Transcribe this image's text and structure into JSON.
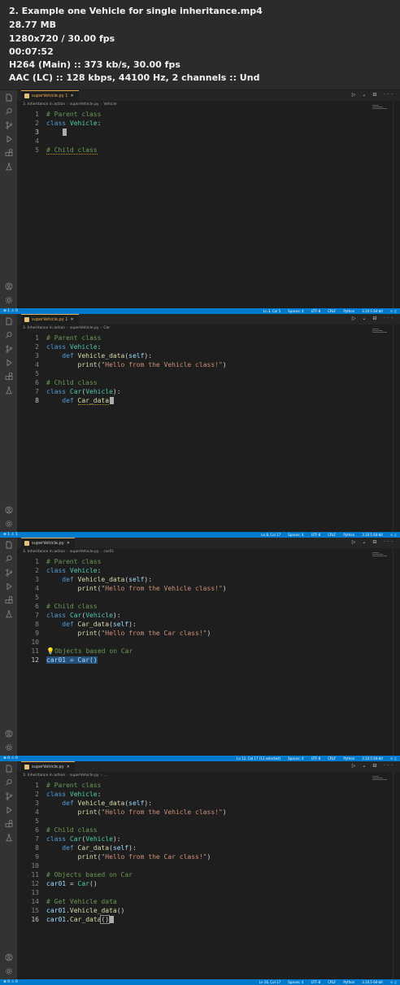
{
  "header": {
    "title": "2. Example one Vehicle for single inheritance.mp4",
    "size": "28.77 MB",
    "resolution": "1280x720 / 30.00 fps",
    "duration": "00:07:52",
    "video": "H264 (Main) :: 373 kb/s, 30.00 fps",
    "audio": "AAC (LC) :: 128 kbps, 44100 Hz, 2 channels :: Und"
  },
  "activity_icons": [
    "files-icon",
    "search-icon",
    "source-control-icon",
    "run-debug-icon",
    "extensions-icon",
    "testing-icon"
  ],
  "bottom_icons": [
    "account-icon",
    "settings-gear-icon"
  ],
  "tab_actions": "▷ ⌄ ⊟ ···",
  "frames": [
    {
      "tab_name": "superVehicle.py 1",
      "tab_close": "✕",
      "tab_modified": true,
      "breadcrumb": [
        "3. Inheritance in action",
        "superVehicle.py",
        "Vehicle"
      ],
      "status_left": "⊗ 1 ⚠ 0",
      "status_right": [
        "Ln 3, Col 5",
        "Spaces: 4",
        "UTF-8",
        "CRLF",
        "Python",
        "3.10.5 64-bit",
        "⟐ ♫"
      ],
      "lines": [
        {
          "n": "1",
          "tokens": [
            {
              "t": "# Parent class",
              "c": "c-comment"
            }
          ]
        },
        {
          "n": "2",
          "tokens": [
            {
              "t": "class ",
              "c": "c-kw"
            },
            {
              "t": "Vehicle",
              "c": "c-cls"
            },
            {
              "t": ":",
              "c": "c-plain"
            }
          ]
        },
        {
          "n": "3",
          "cur": true,
          "tokens": [
            {
              "t": "    ",
              "c": "c-plain"
            }
          ],
          "cursor": true
        },
        {
          "n": "4",
          "tokens": []
        },
        {
          "n": "5",
          "tokens": [
            {
              "t": "# Child class",
              "c": "c-comment squiggle"
            }
          ]
        }
      ]
    },
    {
      "tab_name": "superVehicle.py 1",
      "tab_close": "✕",
      "tab_modified": true,
      "breadcrumb": [
        "3. Inheritance in action",
        "superVehicle.py",
        "Car"
      ],
      "status_left": "⊗ 1 ⚠ 1",
      "status_right": [
        "Ln 8, Col 17",
        "Spaces: 4",
        "UTF-8",
        "CRLF",
        "Python",
        "3.10.5 64-bit",
        "⟐ ♫"
      ],
      "lines": [
        {
          "n": "1",
          "tokens": [
            {
              "t": "# Parent class",
              "c": "c-comment"
            }
          ]
        },
        {
          "n": "2",
          "tokens": [
            {
              "t": "class ",
              "c": "c-kw"
            },
            {
              "t": "Vehicle",
              "c": "c-cls"
            },
            {
              "t": ":",
              "c": "c-plain"
            }
          ]
        },
        {
          "n": "3",
          "tokens": [
            {
              "t": "    def ",
              "c": "c-kw"
            },
            {
              "t": "Vehicle_data",
              "c": "c-fn"
            },
            {
              "t": "(",
              "c": "c-plain"
            },
            {
              "t": "self",
              "c": "c-var"
            },
            {
              "t": "):",
              "c": "c-plain"
            }
          ]
        },
        {
          "n": "4",
          "tokens": [
            {
              "t": "        ",
              "c": "c-plain"
            },
            {
              "t": "print",
              "c": "c-fn"
            },
            {
              "t": "(",
              "c": "c-plain"
            },
            {
              "t": "\"Hello from the Vehicle class!\"",
              "c": "c-str"
            },
            {
              "t": ")",
              "c": "c-plain"
            }
          ]
        },
        {
          "n": "5",
          "tokens": []
        },
        {
          "n": "6",
          "tokens": [
            {
              "t": "# Child class",
              "c": "c-comment"
            }
          ]
        },
        {
          "n": "7",
          "tokens": [
            {
              "t": "class ",
              "c": "c-kw"
            },
            {
              "t": "Car",
              "c": "c-cls"
            },
            {
              "t": "(",
              "c": "c-plain"
            },
            {
              "t": "Vehicle",
              "c": "c-cls"
            },
            {
              "t": "):",
              "c": "c-plain"
            }
          ]
        },
        {
          "n": "8",
          "cur": true,
          "tokens": [
            {
              "t": "    def ",
              "c": "c-kw"
            },
            {
              "t": "Car_data",
              "c": "c-fn squiggle"
            }
          ],
          "cursor": true
        }
      ]
    },
    {
      "tab_name": "superVehicle.py",
      "tab_close": "✕",
      "tab_modified": false,
      "breadcrumb": [
        "3. Inheritance in action",
        "superVehicle.py",
        "car01"
      ],
      "status_left": "⊗ 0 ⚠ 0",
      "status_right": [
        "Ln 12, Col 17 (13 selected)",
        "Spaces: 4",
        "UTF-8",
        "CRLF",
        "Python",
        "3.10.5 64-bit",
        "⟐ ♫"
      ],
      "lines": [
        {
          "n": "1",
          "tokens": [
            {
              "t": "# Parent class",
              "c": "c-comment"
            }
          ]
        },
        {
          "n": "2",
          "tokens": [
            {
              "t": "class ",
              "c": "c-kw"
            },
            {
              "t": "Vehicle",
              "c": "c-cls"
            },
            {
              "t": ":",
              "c": "c-plain"
            }
          ]
        },
        {
          "n": "3",
          "tokens": [
            {
              "t": "    def ",
              "c": "c-kw"
            },
            {
              "t": "Vehicle_data",
              "c": "c-fn"
            },
            {
              "t": "(",
              "c": "c-plain"
            },
            {
              "t": "self",
              "c": "c-var"
            },
            {
              "t": "):",
              "c": "c-plain"
            }
          ]
        },
        {
          "n": "4",
          "tokens": [
            {
              "t": "        ",
              "c": "c-plain"
            },
            {
              "t": "print",
              "c": "c-fn"
            },
            {
              "t": "(",
              "c": "c-plain"
            },
            {
              "t": "\"Hello from the Vehicle class!\"",
              "c": "c-str"
            },
            {
              "t": ")",
              "c": "c-plain"
            }
          ]
        },
        {
          "n": "5",
          "tokens": []
        },
        {
          "n": "6",
          "tokens": [
            {
              "t": "# Child class",
              "c": "c-comment"
            }
          ]
        },
        {
          "n": "7",
          "tokens": [
            {
              "t": "class ",
              "c": "c-kw"
            },
            {
              "t": "Car",
              "c": "c-cls"
            },
            {
              "t": "(",
              "c": "c-plain"
            },
            {
              "t": "Vehicle",
              "c": "c-cls"
            },
            {
              "t": "):",
              "c": "c-plain"
            }
          ]
        },
        {
          "n": "8",
          "tokens": [
            {
              "t": "    def ",
              "c": "c-kw"
            },
            {
              "t": "Car_data",
              "c": "c-fn"
            },
            {
              "t": "(",
              "c": "c-plain"
            },
            {
              "t": "self",
              "c": "c-var"
            },
            {
              "t": "):",
              "c": "c-plain"
            }
          ]
        },
        {
          "n": "9",
          "tokens": [
            {
              "t": "        ",
              "c": "c-plain"
            },
            {
              "t": "print",
              "c": "c-fn"
            },
            {
              "t": "(",
              "c": "c-plain"
            },
            {
              "t": "\"Hello from the Car class!\"",
              "c": "c-str"
            },
            {
              "t": ")",
              "c": "c-plain"
            }
          ]
        },
        {
          "n": "10",
          "tokens": []
        },
        {
          "n": "11",
          "tokens": [
            {
              "t": "💡",
              "c": "lightbulb"
            },
            {
              "t": "Objects based on Car",
              "c": "c-comment"
            }
          ]
        },
        {
          "n": "12",
          "cur": true,
          "tokens": [
            {
              "t": "car01 = Car()",
              "c": "c-var sel"
            }
          ]
        }
      ]
    },
    {
      "tab_name": "superVehicle.py",
      "tab_close": "✕",
      "tab_modified": false,
      "breadcrumb": [
        "3. Inheritance in action",
        "superVehicle.py",
        "..."
      ],
      "status_left": "⊗ 0 ⚠ 0",
      "status_right": [
        "Ln 16, Col 17",
        "Spaces: 4",
        "UTF-8",
        "CRLF",
        "Python",
        "3.10.5 64-bit",
        "⟐ ♫"
      ],
      "lines": [
        {
          "n": "1",
          "tokens": [
            {
              "t": "# Parent class",
              "c": "c-comment"
            }
          ]
        },
        {
          "n": "2",
          "tokens": [
            {
              "t": "class ",
              "c": "c-kw"
            },
            {
              "t": "Vehicle",
              "c": "c-cls"
            },
            {
              "t": ":",
              "c": "c-plain"
            }
          ]
        },
        {
          "n": "3",
          "tokens": [
            {
              "t": "    def ",
              "c": "c-kw"
            },
            {
              "t": "Vehicle_data",
              "c": "c-fn"
            },
            {
              "t": "(",
              "c": "c-plain"
            },
            {
              "t": "self",
              "c": "c-var"
            },
            {
              "t": "):",
              "c": "c-plain"
            }
          ]
        },
        {
          "n": "4",
          "tokens": [
            {
              "t": "        ",
              "c": "c-plain"
            },
            {
              "t": "print",
              "c": "c-fn"
            },
            {
              "t": "(",
              "c": "c-plain"
            },
            {
              "t": "\"Hello from the Vehicle class!\"",
              "c": "c-str"
            },
            {
              "t": ")",
              "c": "c-plain"
            }
          ]
        },
        {
          "n": "5",
          "tokens": []
        },
        {
          "n": "6",
          "tokens": [
            {
              "t": "# Child class",
              "c": "c-comment"
            }
          ]
        },
        {
          "n": "7",
          "tokens": [
            {
              "t": "class ",
              "c": "c-kw"
            },
            {
              "t": "Car",
              "c": "c-cls"
            },
            {
              "t": "(",
              "c": "c-plain"
            },
            {
              "t": "Vehicle",
              "c": "c-cls"
            },
            {
              "t": "):",
              "c": "c-plain"
            }
          ]
        },
        {
          "n": "8",
          "tokens": [
            {
              "t": "    def ",
              "c": "c-kw"
            },
            {
              "t": "Car_data",
              "c": "c-fn"
            },
            {
              "t": "(",
              "c": "c-plain"
            },
            {
              "t": "self",
              "c": "c-var"
            },
            {
              "t": "):",
              "c": "c-plain"
            }
          ]
        },
        {
          "n": "9",
          "tokens": [
            {
              "t": "        ",
              "c": "c-plain"
            },
            {
              "t": "print",
              "c": "c-fn"
            },
            {
              "t": "(",
              "c": "c-plain"
            },
            {
              "t": "\"Hello from the Car class!\"",
              "c": "c-str"
            },
            {
              "t": ")",
              "c": "c-plain"
            }
          ]
        },
        {
          "n": "10",
          "tokens": []
        },
        {
          "n": "11",
          "tokens": [
            {
              "t": "# Objects based on Car",
              "c": "c-comment"
            }
          ]
        },
        {
          "n": "12",
          "tokens": [
            {
              "t": "car01",
              "c": "c-var"
            },
            {
              "t": " = ",
              "c": "c-plain"
            },
            {
              "t": "Car",
              "c": "c-cls"
            },
            {
              "t": "()",
              "c": "c-plain"
            }
          ]
        },
        {
          "n": "13",
          "tokens": []
        },
        {
          "n": "14",
          "tokens": [
            {
              "t": "# Get Vehicle data",
              "c": "c-comment"
            }
          ]
        },
        {
          "n": "15",
          "tokens": [
            {
              "t": "car01",
              "c": "c-var"
            },
            {
              "t": ".",
              "c": "c-plain"
            },
            {
              "t": "Vehicle_data",
              "c": "c-fn"
            },
            {
              "t": "()",
              "c": "c-plain"
            }
          ]
        },
        {
          "n": "16",
          "cur": true,
          "tokens": [
            {
              "t": "car01",
              "c": "c-var"
            },
            {
              "t": ".",
              "c": "c-plain"
            },
            {
              "t": "Car_data",
              "c": "c-fn"
            },
            {
              "t": "()",
              "c": "c-plain bracket-box"
            }
          ],
          "cursor": true
        }
      ]
    }
  ]
}
